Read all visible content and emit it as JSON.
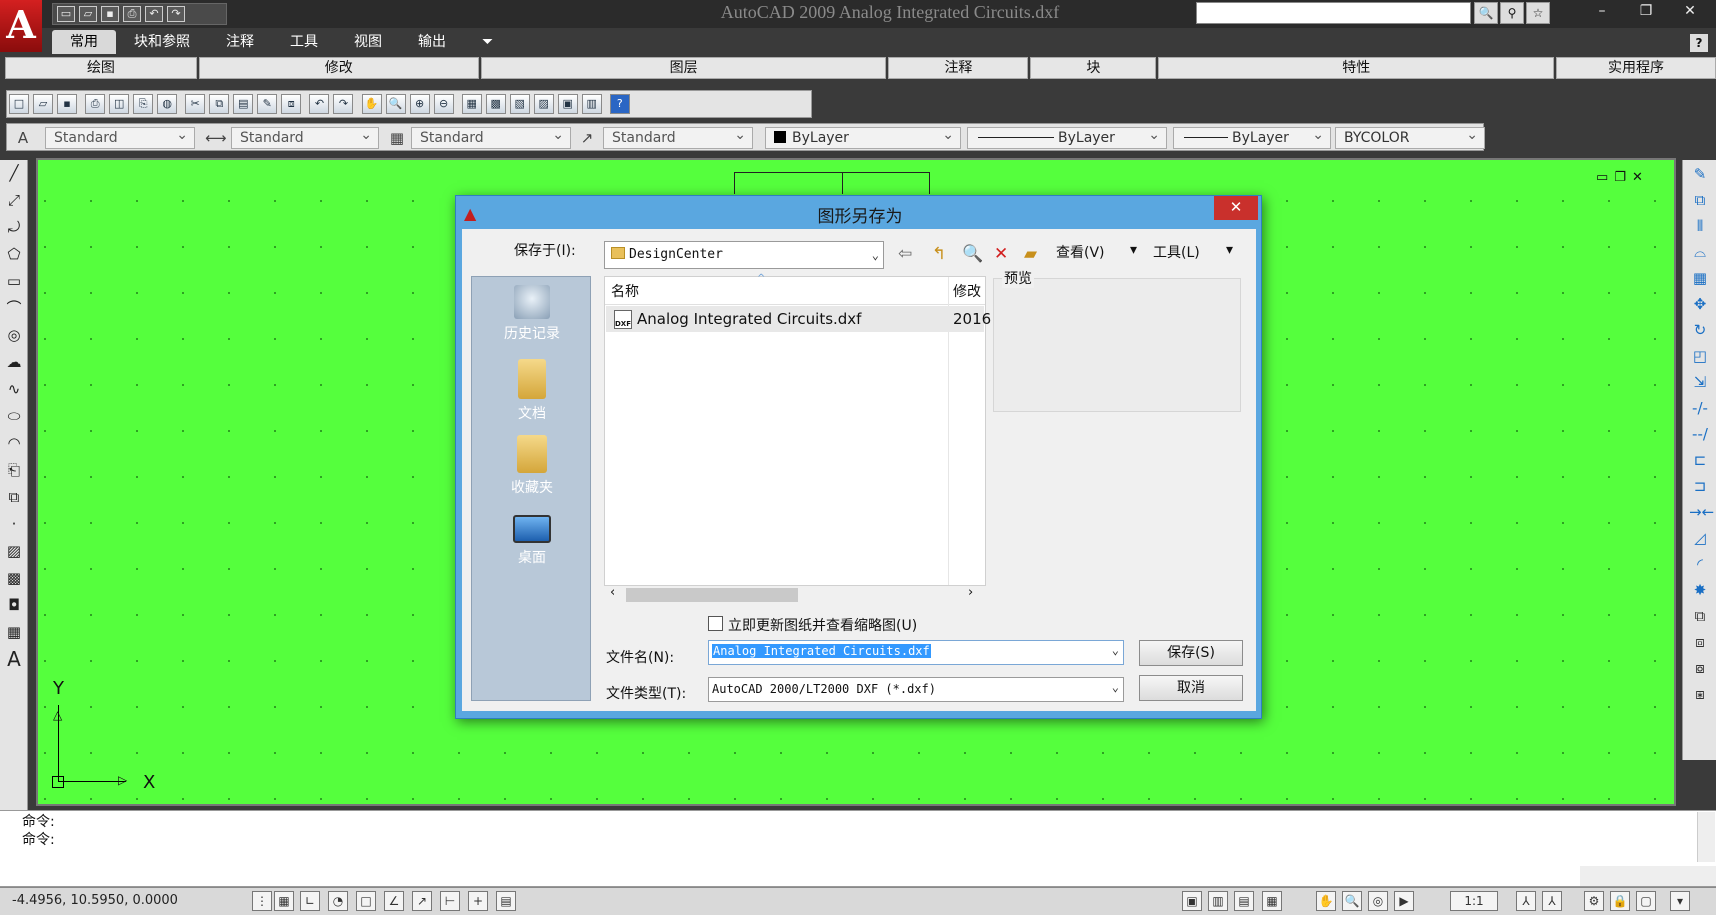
{
  "app": {
    "logo": "A",
    "title": "AutoCAD 2009 Analog Integrated Circuits.dxf",
    "window_controls": [
      "–",
      "❐",
      "✕"
    ],
    "search_buttons": [
      "🔍",
      "⚲",
      "☆"
    ]
  },
  "ribbon": {
    "tabs": [
      "常用",
      "块和参照",
      "注释",
      "工具",
      "视图",
      "输出"
    ],
    "active_tab": "常用",
    "panels": [
      "绘图",
      "修改",
      "图层",
      "注释",
      "块",
      "特性",
      "实用程序"
    ],
    "help": "?"
  },
  "toolbar_styles": {
    "text_style": "Standard",
    "dim_style": "Standard",
    "table_style": "Standard",
    "mleader_style": "Standard",
    "color": "ByLayer",
    "linetype": "ByLayer",
    "lineweight": "ByLayer",
    "plotstyle": "BYCOLOR"
  },
  "canvas": {
    "bg_color": "#55ff3d",
    "ucs_y": "Y",
    "ucs_x": "X",
    "mdi_controls": [
      "▭",
      "❐",
      "✕"
    ]
  },
  "command": {
    "lines": [
      "命令:",
      "命令:"
    ]
  },
  "status": {
    "coords": "-4.4956, 10.5950, 0.0000",
    "annotation_scale": "1:1"
  },
  "dialog": {
    "title": "图形另存为",
    "close": "✕",
    "save_in_label": "保存于(I):",
    "save_in_value": "DesignCenter",
    "view_menu": "查看(V)",
    "tools_menu": "工具(L)",
    "places": [
      "历史记录",
      "文档",
      "收藏夹",
      "桌面"
    ],
    "columns": [
      "名称",
      "修改"
    ],
    "files": [
      {
        "name": "Analog Integrated Circuits.dxf",
        "modified": "2016",
        "icon": "DXF"
      }
    ],
    "preview_label": "预览",
    "update_thumbnail_label": "立即更新图纸并查看缩略图(U)",
    "filename_label": "文件名(N):",
    "filename_value": "Analog Integrated Circuits.dxf",
    "filetype_label": "文件类型(T):",
    "filetype_value": "AutoCAD 2000/LT2000 DXF (*.dxf)",
    "save_button": "保存(S)",
    "cancel_button": "取消"
  }
}
